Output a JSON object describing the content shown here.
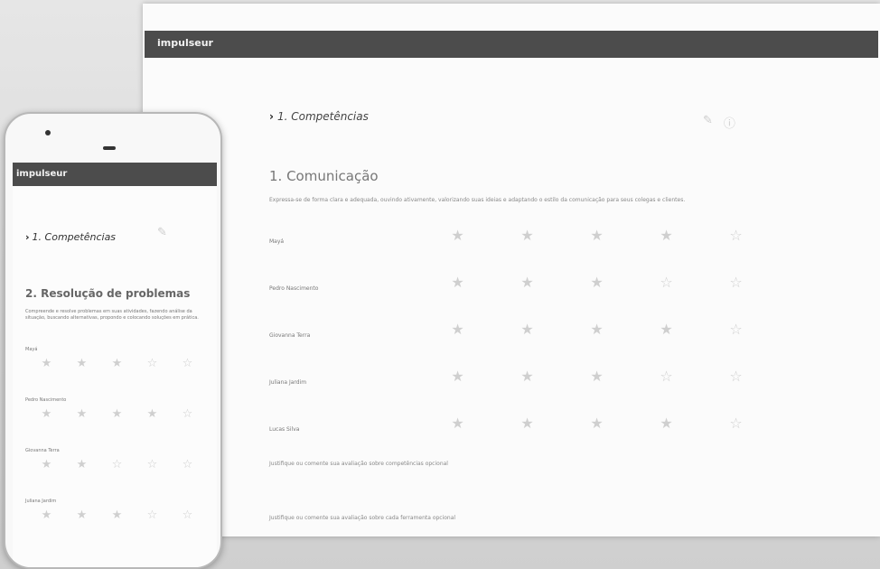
{
  "app": {
    "logo": "impulseur"
  },
  "desktop": {
    "breadcrumb": "1. Competências",
    "section_title": "1. Comunicação",
    "description": "Expressa-se de forma clara e adequada, ouvindo ativamente, valorizando suas ideias e adaptando o estilo da comunicação para seus colegas e clientes.",
    "rows": [
      {
        "label": "Mayá",
        "stars": [
          {
            "glyph": "★",
            "caption": ""
          },
          {
            "glyph": "★",
            "caption": ""
          },
          {
            "glyph": "★",
            "caption": ""
          },
          {
            "glyph": "★",
            "caption": ""
          },
          {
            "glyph": "☆",
            "caption": ""
          }
        ]
      },
      {
        "label": "Pedro Nascimento",
        "stars": [
          {
            "glyph": "★",
            "caption": ""
          },
          {
            "glyph": "★",
            "caption": ""
          },
          {
            "glyph": "★",
            "caption": ""
          },
          {
            "glyph": "☆",
            "caption": ""
          },
          {
            "glyph": "☆",
            "caption": ""
          }
        ]
      },
      {
        "label": "Giovanna Terra",
        "stars": [
          {
            "glyph": "★",
            "caption": ""
          },
          {
            "glyph": "★",
            "caption": ""
          },
          {
            "glyph": "★",
            "caption": ""
          },
          {
            "glyph": "★",
            "caption": ""
          },
          {
            "glyph": "☆",
            "caption": ""
          }
        ]
      },
      {
        "label": "Juliana Jardim",
        "stars": [
          {
            "glyph": "★",
            "caption": ""
          },
          {
            "glyph": "★",
            "caption": ""
          },
          {
            "glyph": "★",
            "caption": ""
          },
          {
            "glyph": "☆",
            "caption": ""
          },
          {
            "glyph": "☆",
            "caption": ""
          }
        ]
      },
      {
        "label": "Lucas Silva",
        "stars": [
          {
            "glyph": "★",
            "caption": ""
          },
          {
            "glyph": "★",
            "caption": ""
          },
          {
            "glyph": "★",
            "caption": ""
          },
          {
            "glyph": "★",
            "caption": ""
          },
          {
            "glyph": "☆",
            "caption": ""
          }
        ]
      }
    ],
    "note_1": "Justifique ou comente sua avaliação sobre competências opcional",
    "note_2": "Justifique ou comente sua avaliação sobre cada ferramenta opcional"
  },
  "phone": {
    "breadcrumb": "1. Competências",
    "section_title": "2. Resolução de problemas",
    "description": "Compreende e resolve problemas em suas atividades, fazendo análise da situação, buscando alternativas, propondo e colocando soluções em prática.",
    "rows": [
      {
        "label": "Mayá",
        "stars": [
          {
            "glyph": "★",
            "caption": ""
          },
          {
            "glyph": "★",
            "caption": ""
          },
          {
            "glyph": "★",
            "caption": ""
          },
          {
            "glyph": "☆",
            "caption": ""
          },
          {
            "glyph": "☆",
            "caption": ""
          }
        ]
      },
      {
        "label": "Pedro Nascimento",
        "stars": [
          {
            "glyph": "★",
            "caption": ""
          },
          {
            "glyph": "★",
            "caption": ""
          },
          {
            "glyph": "★",
            "caption": ""
          },
          {
            "glyph": "★",
            "caption": ""
          },
          {
            "glyph": "☆",
            "caption": ""
          }
        ]
      },
      {
        "label": "Giovanna Terra",
        "stars": [
          {
            "glyph": "★",
            "caption": ""
          },
          {
            "glyph": "★",
            "caption": ""
          },
          {
            "glyph": "☆",
            "caption": ""
          },
          {
            "glyph": "☆",
            "caption": ""
          },
          {
            "glyph": "☆",
            "caption": ""
          }
        ]
      },
      {
        "label": "Juliana Jardim",
        "stars": [
          {
            "glyph": "★",
            "caption": ""
          },
          {
            "glyph": "★",
            "caption": ""
          },
          {
            "glyph": "★",
            "caption": ""
          },
          {
            "glyph": "☆",
            "caption": ""
          },
          {
            "glyph": "☆",
            "caption": ""
          }
        ]
      }
    ]
  },
  "colors": {
    "header_bar": "#4c4c4c",
    "star": "#cfcfcf"
  }
}
